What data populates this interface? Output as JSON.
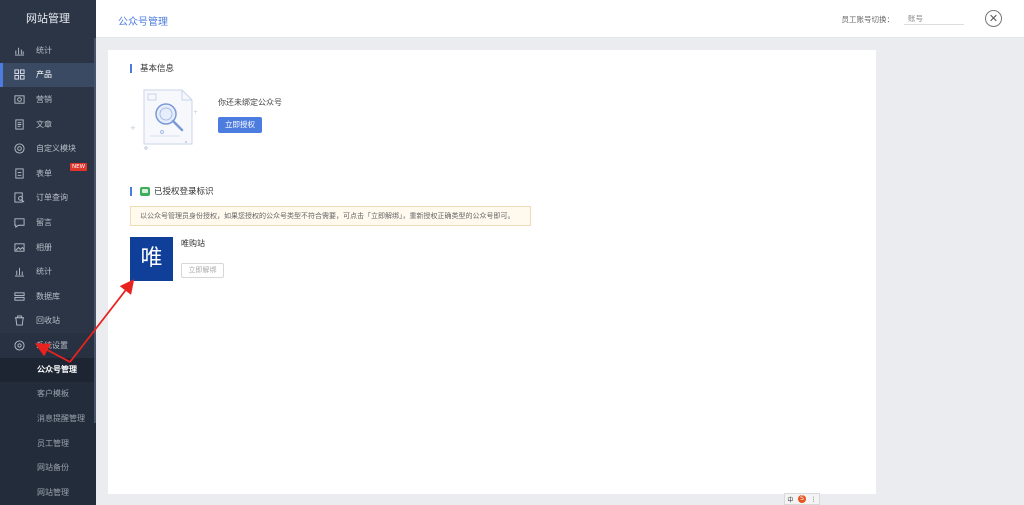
{
  "sidebar": {
    "title": "网站管理",
    "items": [
      {
        "label": "统计",
        "icon": "chart-icon"
      },
      {
        "label": "产品",
        "icon": "grid-icon",
        "active": true
      },
      {
        "label": "营销",
        "icon": "photo-icon"
      },
      {
        "label": "文章",
        "icon": "document-icon"
      },
      {
        "label": "自定义模块",
        "icon": "target-icon"
      },
      {
        "label": "表单",
        "icon": "form-icon",
        "badge": "NEW"
      },
      {
        "label": "订单查询",
        "icon": "search-doc-icon"
      },
      {
        "label": "留言",
        "icon": "message-icon"
      },
      {
        "label": "相册",
        "icon": "image-icon"
      },
      {
        "label": "统计",
        "icon": "bar-chart-icon"
      },
      {
        "label": "数据库",
        "icon": "database-icon"
      },
      {
        "label": "回收站",
        "icon": "trash-icon"
      },
      {
        "label": "系统设置",
        "icon": "settings-icon",
        "open": true
      }
    ],
    "subitems": [
      {
        "label": "公众号管理",
        "current": true
      },
      {
        "label": "客户模板"
      },
      {
        "label": "消息提醒管理"
      },
      {
        "label": "员工管理"
      },
      {
        "label": "网站备份"
      },
      {
        "label": "网站管理"
      }
    ]
  },
  "topbar": {
    "title": "公众号管理",
    "right_label": "员工账号切换：",
    "right_value": "账号",
    "close_glyph": "✕"
  },
  "basic": {
    "title": "基本信息",
    "auth_text": "你还未绑定公众号",
    "auth_button": "立即授权"
  },
  "bind": {
    "title": "已授权登录标识",
    "notice": "以公众号管理员身份授权，如果您授权的公众号类型不符合需要，可点击「立即解绑」，重新授权正确类型的公众号即可。",
    "account_logo_char": "唯",
    "account_name": "唯购站",
    "unbind_button": "立即解绑"
  },
  "tray": {
    "text": "中",
    "logo_char": "S",
    "more": "⋮"
  },
  "colors": {
    "sidebar_bg": "#2b3545",
    "accent": "#4c7ce0",
    "account_logo_bg": "#0f3f99",
    "badge_red": "#e0352b",
    "annotation_arrow": "#e8231f"
  }
}
